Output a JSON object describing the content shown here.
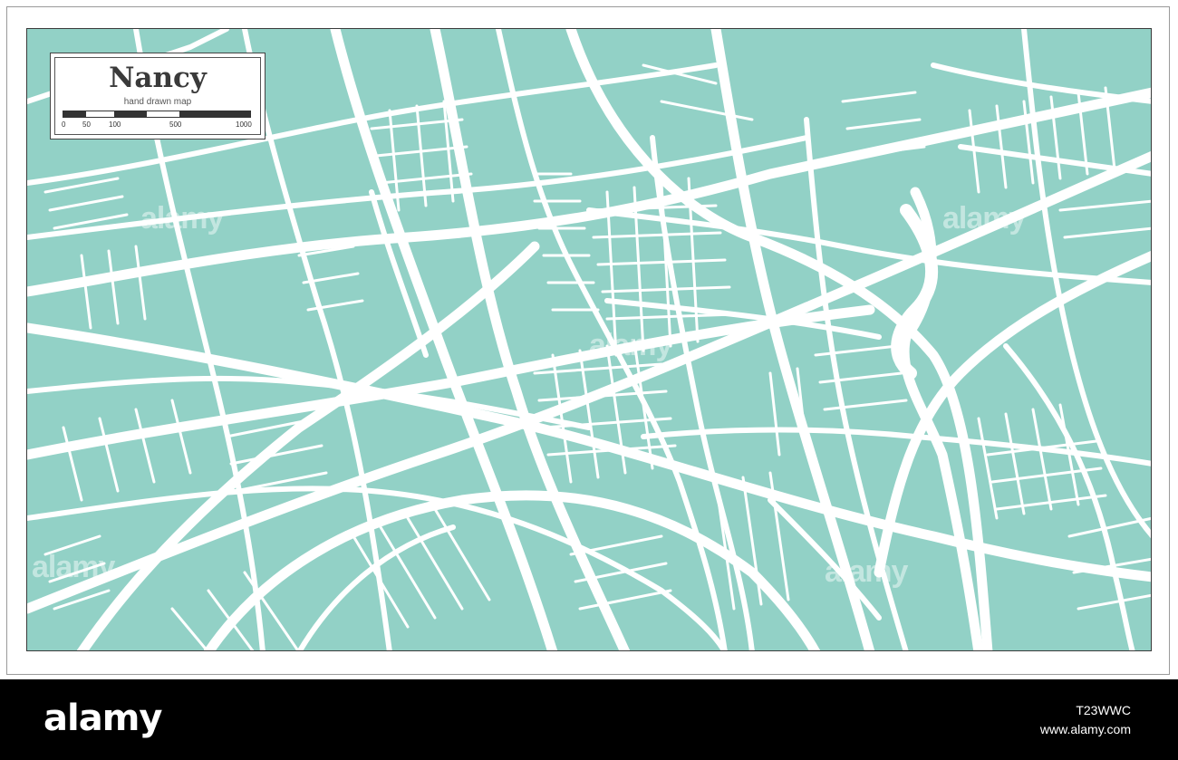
{
  "title_box": {
    "city": "Nancy",
    "subtitle": "hand drawn map",
    "scale_labels": [
      "0",
      "50",
      "100",
      "500",
      "1000"
    ]
  },
  "colors": {
    "land": "#92d1c6",
    "roads": "#ffffff",
    "frame": "#3a3a3a",
    "bottom_bar": "#000000"
  },
  "watermark": {
    "text": "alamy"
  },
  "footer": {
    "brand": "alamy",
    "image_id": "T23WWC",
    "site": "www.alamy.com"
  }
}
